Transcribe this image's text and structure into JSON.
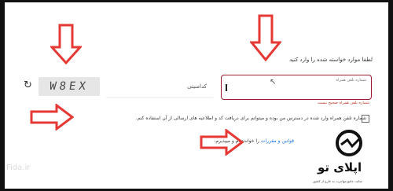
{
  "form": {
    "title": "لطفا موارد خواسته شده را وارد کنید",
    "phone_label": "شماره تلفن همراه",
    "phone_error": "شماره تلفن همراه صحیح نیست",
    "captcha_placeholder": "کدامنیتی",
    "captcha_text": "W8EX",
    "consent_text": "شماره تلفن همراه وارد شده در دسترس من بوده و میتوانم برای دریافت کد و اطلاعیه های ارسالی از آن استفاده کنم.",
    "rules_link": "قوانین و مقررات",
    "rules_suffix": "را خوانده ام و میپذیرم."
  },
  "watermark": "Fida.ir",
  "logo": {
    "name": "اپلای تو",
    "tagline": "سایت جامع مهاجرت به خارج از کشور"
  },
  "colors": {
    "arrow": "#e53935",
    "field_border": "#9b1c2e",
    "link": "#1a73e8"
  }
}
